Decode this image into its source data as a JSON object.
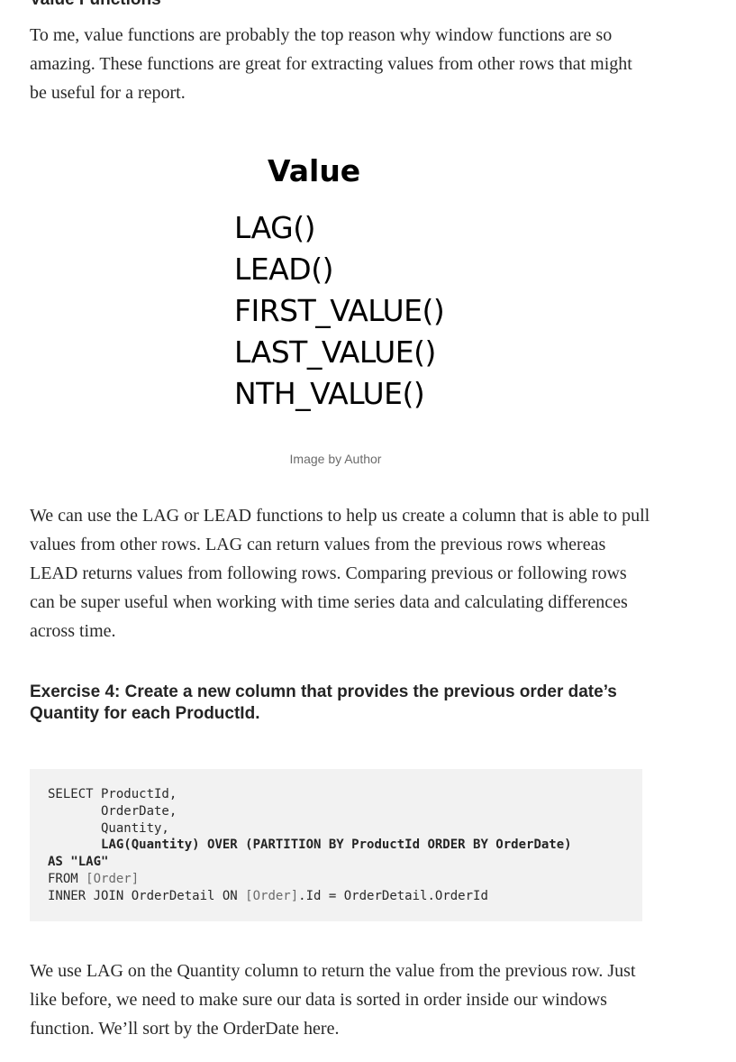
{
  "section": {
    "heading": "Value Functions",
    "intro": "To me, value functions are probably the top reason why window functions are so amazing. These functions are great for extracting values from other rows that might be useful for a report."
  },
  "figure": {
    "title": "Value",
    "items": [
      "LAG()",
      "LEAD()",
      "FIRST_VALUE()",
      "LAST_VALUE()",
      "NTH_VALUE()"
    ],
    "caption": "Image by Author"
  },
  "body": {
    "lag_lead_paragraph": "We can use the LAG or LEAD functions to help us create a column that is able to pull values from other rows. LAG can return values from the previous rows whereas LEAD returns values from following rows. Comparing previous or following rows can be super useful when working with time series data and calculating differences across time."
  },
  "exercise": {
    "title": "Exercise 4: Create a new column that provides the previous order date’s Quantity for each ProductId."
  },
  "code": {
    "line1": "SELECT ProductId,",
    "line2": "       OrderDate,",
    "line3": "       Quantity,",
    "line4_indent": "       ",
    "line4": "LAG(Quantity) OVER (PARTITION BY ProductId ORDER BY OrderDate)",
    "line5": "AS \"LAG\"",
    "line6_kw": "FROM ",
    "line6_table": "[Order]",
    "line7_a": "INNER JOIN OrderDetail ON ",
    "line7_b": "[Order]",
    "line7_c": ".Id = OrderDetail.OrderId"
  },
  "closing": {
    "paragraph": "We use LAG on the Quantity column to return the value from the previous row. Just like before, we need to make sure our data is sorted in order inside our windows function. We’ll sort by the OrderDate here."
  }
}
